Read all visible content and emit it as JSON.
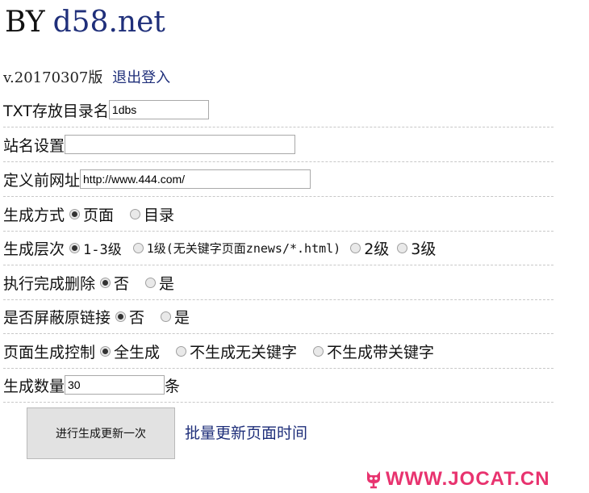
{
  "header": {
    "by": "BY",
    "site": "d58.net"
  },
  "version": {
    "text": "v.20170307版",
    "logout": "退出登入"
  },
  "form": {
    "txt_dir": {
      "label": "TXT存放目录名",
      "value": "1dbs"
    },
    "site_name": {
      "label": "站名设置",
      "value": ""
    },
    "custom_url": {
      "label": "定义前网址",
      "value": "http://www.444.com/"
    },
    "gen_mode": {
      "label": "生成方式",
      "options": [
        "页面",
        "目录"
      ],
      "selected": 0
    },
    "gen_level": {
      "label": "生成层次",
      "options": [
        "1-3级",
        "1级(无关键字页面znews/*.html)",
        "2级",
        "3级"
      ],
      "selected": 0
    },
    "delete_after": {
      "label": "执行完成删除",
      "options": [
        "否",
        "是"
      ],
      "selected": 0
    },
    "block_links": {
      "label": "是否屏蔽原链接",
      "options": [
        "否",
        "是"
      ],
      "selected": 0
    },
    "page_control": {
      "label": "页面生成控制",
      "options": [
        "全生成",
        "不生成无关键字",
        "不生成带关键字"
      ],
      "selected": 0
    },
    "gen_count": {
      "label": "生成数量",
      "value": "30",
      "unit": "条"
    }
  },
  "actions": {
    "generate": "进行生成更新一次",
    "batch_update": "批量更新页面时间"
  },
  "watermark": {
    "text": "WWW.JOCAT.CN",
    "color": "#e8336f"
  }
}
